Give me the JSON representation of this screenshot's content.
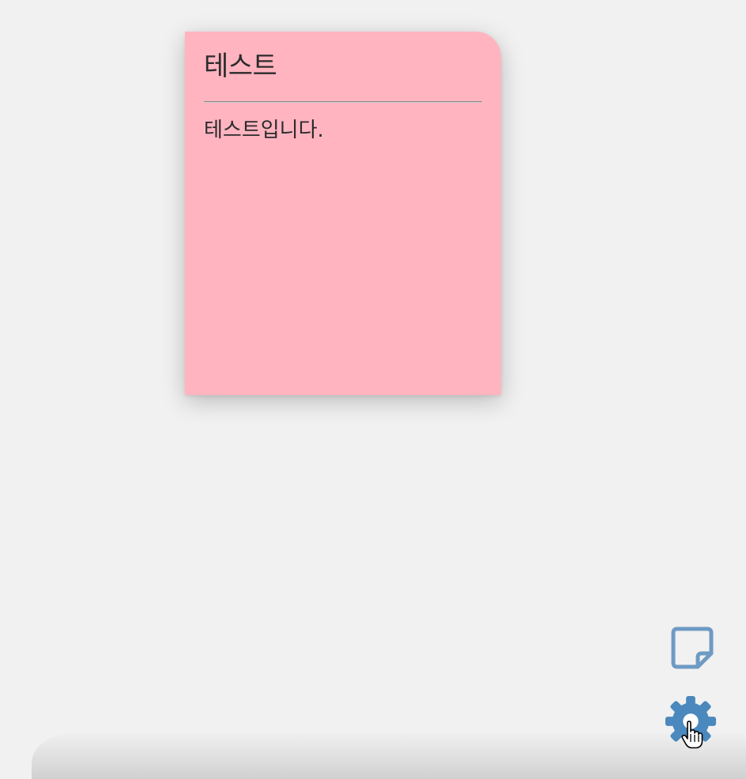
{
  "note": {
    "title": "테스트",
    "body": "테스트입니다."
  },
  "actions": {
    "new_note_icon": "sticky-note-icon",
    "settings_icon": "gear-icon"
  },
  "colors": {
    "note_background": "#ffb4c0",
    "icon_note": "#6e9ac4",
    "icon_settings": "#4a88bd"
  }
}
